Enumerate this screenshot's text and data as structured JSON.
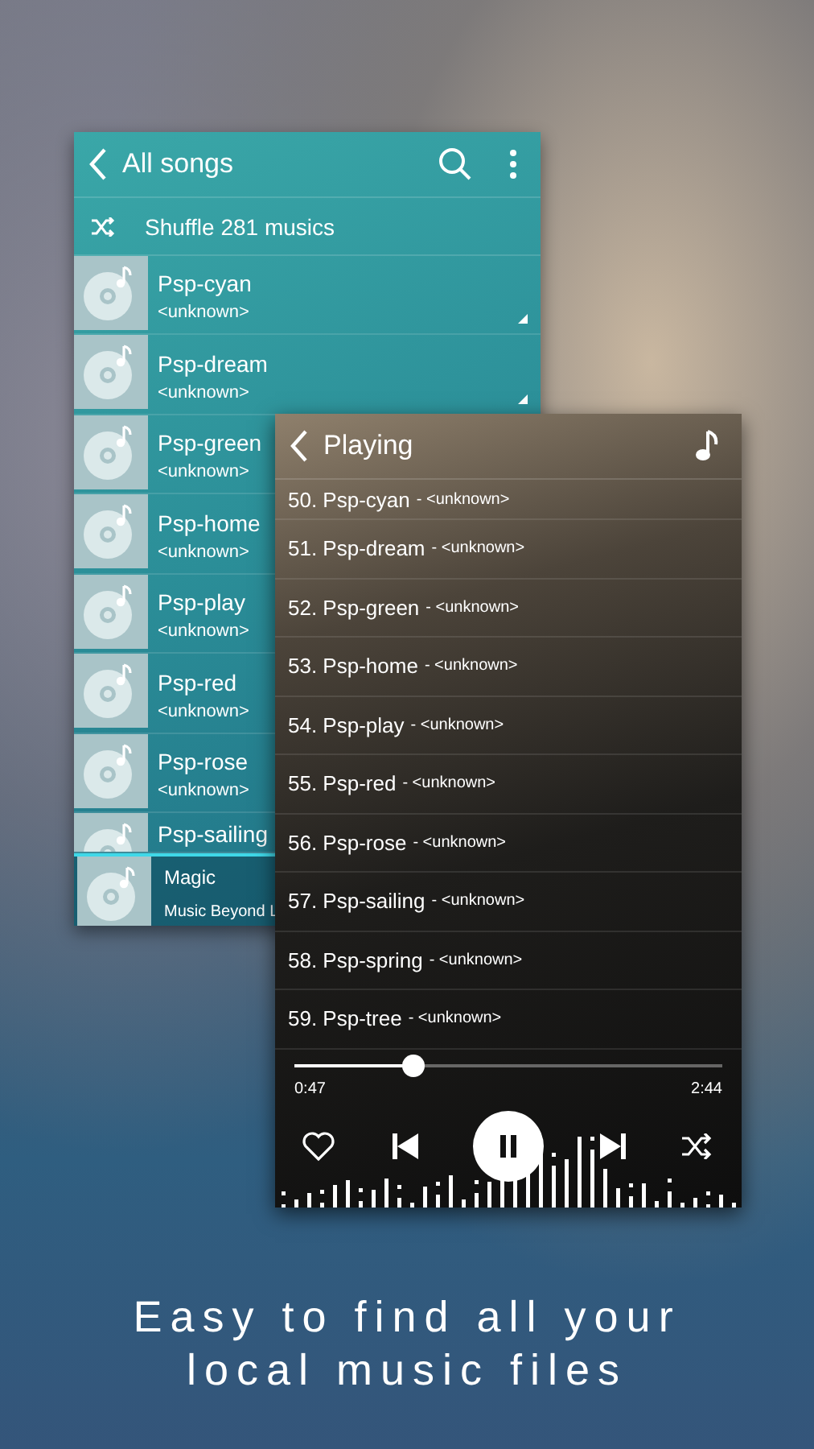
{
  "library": {
    "title": "All songs",
    "shuffle_label": "Shuffle 281 musics",
    "songs": [
      {
        "title": "Psp-cyan",
        "artist": "<unknown>"
      },
      {
        "title": "Psp-dream",
        "artist": "<unknown>"
      },
      {
        "title": "Psp-green",
        "artist": "<unknown>"
      },
      {
        "title": "Psp-home",
        "artist": "<unknown>"
      },
      {
        "title": "Psp-play",
        "artist": "<unknown>"
      },
      {
        "title": "Psp-red",
        "artist": "<unknown>"
      },
      {
        "title": "Psp-rose",
        "artist": "<unknown>"
      },
      {
        "title": "Psp-sailing"
      }
    ],
    "now_playing": {
      "title": "Magic",
      "artist": "Music Beyond L"
    }
  },
  "player": {
    "title": "Playing",
    "queue": [
      {
        "title": "50. Psp-cyan",
        "artist": "- <unknown>"
      },
      {
        "title": "51. Psp-dream",
        "artist": "- <unknown>"
      },
      {
        "title": "52. Psp-green",
        "artist": "- <unknown>"
      },
      {
        "title": "53. Psp-home",
        "artist": "- <unknown>"
      },
      {
        "title": "54. Psp-play",
        "artist": "- <unknown>"
      },
      {
        "title": "55. Psp-red",
        "artist": "- <unknown>"
      },
      {
        "title": "56. Psp-rose",
        "artist": "- <unknown>"
      },
      {
        "title": "57. Psp-sailing",
        "artist": "- <unknown>"
      },
      {
        "title": "58. Psp-spring",
        "artist": "- <unknown>"
      },
      {
        "title": "59. Psp-tree",
        "artist": "- <unknown>"
      }
    ],
    "progress": {
      "level": 0.28,
      "elapsed": "0:47",
      "total": "2:44"
    }
  },
  "caption": [
    "Easy to find all your",
    "local music files"
  ]
}
